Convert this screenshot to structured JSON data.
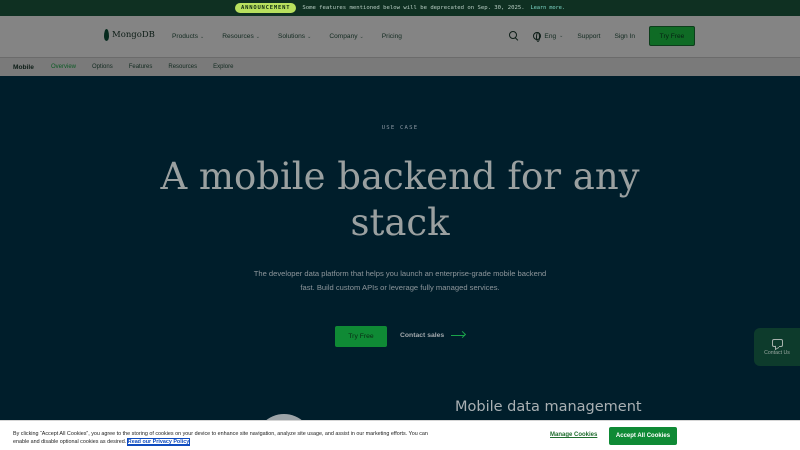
{
  "announcement": {
    "badge": "ANNOUNCEMENT",
    "text": "Some features mentioned below will be deprecated on Sep. 30, 2025.",
    "link": "Learn more."
  },
  "header": {
    "logo": "MongoDB",
    "nav": [
      {
        "label": "Products",
        "icon": "chevron-down-icon"
      },
      {
        "label": "Resources",
        "icon": "chevron-down-icon"
      },
      {
        "label": "Solutions",
        "icon": "chevron-down-icon"
      },
      {
        "label": "Company",
        "icon": "chevron-down-icon"
      },
      {
        "label": "Pricing"
      }
    ],
    "language": "Eng",
    "support": "Support",
    "sign_in": "Sign In",
    "try_free": "Try Free"
  },
  "subnav": {
    "title": "Mobile",
    "items": [
      {
        "label": "Overview",
        "active": true
      },
      {
        "label": "Options"
      },
      {
        "label": "Features"
      },
      {
        "label": "Resources"
      },
      {
        "label": "Explore"
      }
    ]
  },
  "hero": {
    "eyebrow": "USE CASE",
    "title": "A mobile backend for any stack",
    "subtitle": "The developer data platform that helps you launch an enterprise-grade mobile backend fast. Build custom APIs or leverage fully managed services.",
    "cta_primary": "Try Free",
    "cta_secondary": "Contact sales"
  },
  "contact_tab": {
    "label": "Contact Us"
  },
  "section": {
    "title": "Mobile data management"
  },
  "cookie": {
    "text": "By clicking “Accept All Cookies”, you agree to the storing of cookies on your device to enhance site navigation, analyze site usage, and assist in our marketing efforts. You can enable and disable optional cookies as desired.",
    "privacy_link": "Read our Privacy Policy",
    "manage": "Manage Cookies",
    "accept": "Accept All Cookies"
  },
  "colors": {
    "hero_bg": "#001e2b",
    "accent_green": "#0f8a35",
    "announce_badge": "#b8e05e"
  }
}
